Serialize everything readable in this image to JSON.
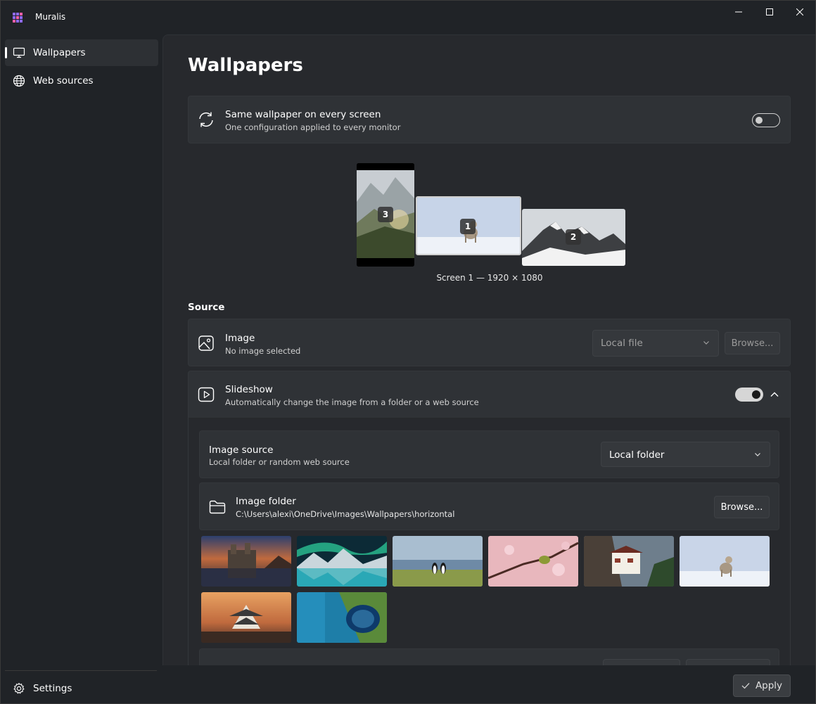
{
  "app": {
    "title": "Muralis"
  },
  "sidebar": {
    "items": [
      {
        "label": "Wallpapers",
        "icon": "monitor-icon",
        "selected": true
      },
      {
        "label": "Web sources",
        "icon": "globe-icon",
        "selected": false
      }
    ],
    "footer": {
      "label": "Settings",
      "icon": "gear-icon"
    }
  },
  "page": {
    "title": "Wallpapers",
    "same_wallpaper": {
      "title": "Same wallpaper on every screen",
      "description": "One configuration applied to every monitor",
      "enabled": false
    },
    "monitors": [
      {
        "number": "3"
      },
      {
        "number": "1",
        "selected": true
      },
      {
        "number": "2"
      }
    ],
    "screen_caption": "Screen 1 — 1920 × 1080",
    "source_label": "Source",
    "image": {
      "title": "Image",
      "description": "No image selected",
      "dropdown_value": "Local file",
      "browse_label": "Browse..."
    },
    "slideshow": {
      "title": "Slideshow",
      "description": "Automatically change the image from a folder or a web source",
      "enabled": true,
      "image_source": {
        "title": "Image source",
        "description": "Local folder or random web source",
        "dropdown_value": "Local folder"
      },
      "image_folder": {
        "title": "Image folder",
        "path": "C:\\Users\\alexi\\OneDrive\\Images\\Wallpapers\\horizontal",
        "browse_label": "Browse..."
      },
      "thumbnails": [
        "castle-lake",
        "aurora-lake",
        "penguins-shore",
        "bird-blossom",
        "cliff-monastery",
        "lynx-snow",
        "japanese-castle-sunset",
        "blue-sinkhole"
      ]
    }
  },
  "footer": {
    "apply_label": "Apply"
  }
}
